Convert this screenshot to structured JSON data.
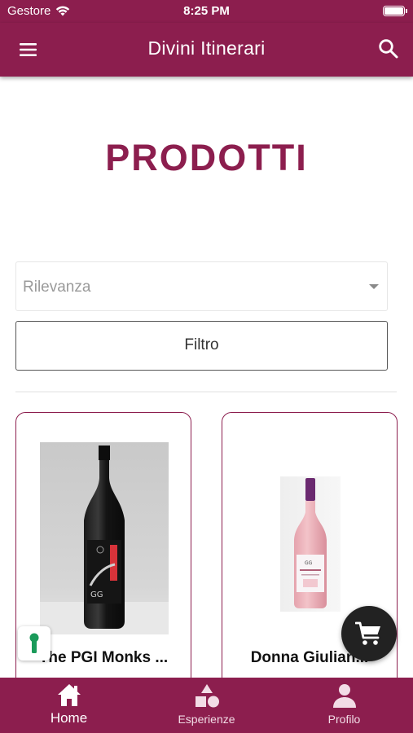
{
  "status_bar": {
    "carrier": "Gestore",
    "time": "8:25 PM"
  },
  "app_bar": {
    "title": "Divini Itinerari",
    "menu_icon": "hamburger-menu-icon",
    "search_icon": "search-icon"
  },
  "page": {
    "heading": "PRODOTTI"
  },
  "sort": {
    "selected": "Rilevanza"
  },
  "filter": {
    "label": "Filtro"
  },
  "products": [
    {
      "name": "The PGI Monks ...",
      "image": "red-wine-bottle"
    },
    {
      "name": "Donna Giulian...",
      "image": "rose-wine-bottle"
    }
  ],
  "floating": {
    "cart_icon": "shopping-cart-icon",
    "accessibility_icon": "keyhole-icon"
  },
  "bottom_nav": {
    "items": [
      {
        "label": "Home",
        "icon": "home-icon",
        "active": true
      },
      {
        "label": "Esperienze",
        "icon": "shapes-icon",
        "active": false
      },
      {
        "label": "Profilo",
        "icon": "person-icon",
        "active": false
      }
    ]
  },
  "colors": {
    "brand": "#8c1e4e",
    "fab": "#222222",
    "accent_green": "#1a9a5a"
  }
}
